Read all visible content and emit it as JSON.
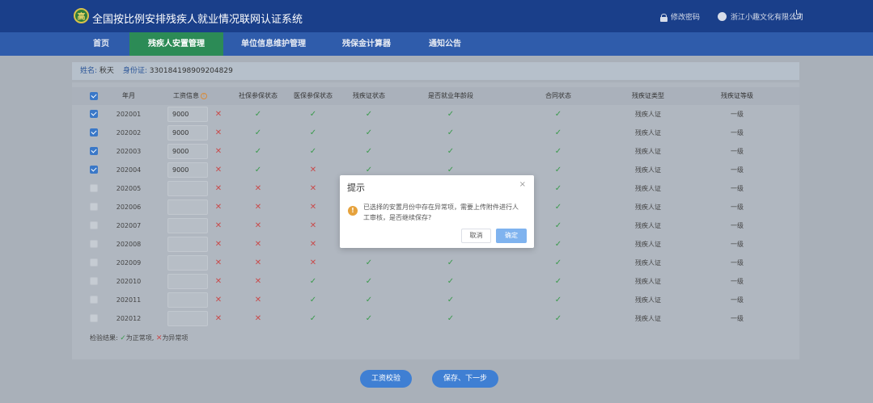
{
  "header": {
    "system_title": "全国按比例安排残疾人就业情况联网认证系统",
    "logo_glyph": "高",
    "change_password": "修改密码",
    "company_name": "浙江小趣文化有限公司"
  },
  "nav": [
    "首页",
    "残疾人安置管理",
    "单位信息维护管理",
    "残保金计算器",
    "通知公告"
  ],
  "info": {
    "name_label": "姓名:",
    "name_value": "秋天",
    "id_label": "身份证:",
    "id_value": "330184198909204829"
  },
  "table": {
    "headers": [
      "年月",
      "工资信息",
      "社保参保状态",
      "医保参保状态",
      "残疾证状态",
      "是否就业年龄段",
      "合同状态",
      "残疾证类型",
      "残疾证等级"
    ],
    "rows": [
      {
        "month": "202001",
        "checked": true,
        "wage": "9000",
        "wage_ok": false,
        "social": true,
        "medical": true,
        "disability": true,
        "age": true,
        "contract": true,
        "type": "残疾人证",
        "level": "一级"
      },
      {
        "month": "202002",
        "checked": true,
        "wage": "9000",
        "wage_ok": false,
        "social": true,
        "medical": true,
        "disability": true,
        "age": true,
        "contract": true,
        "type": "残疾人证",
        "level": "一级"
      },
      {
        "month": "202003",
        "checked": true,
        "wage": "9000",
        "wage_ok": false,
        "social": true,
        "medical": true,
        "disability": true,
        "age": true,
        "contract": true,
        "type": "残疾人证",
        "level": "一级"
      },
      {
        "month": "202004",
        "checked": true,
        "wage": "9000",
        "wage_ok": false,
        "social": true,
        "medical": false,
        "disability": true,
        "age": true,
        "contract": true,
        "type": "残疾人证",
        "level": "一级"
      },
      {
        "month": "202005",
        "checked": false,
        "wage": "",
        "wage_ok": false,
        "social": false,
        "medical": false,
        "disability": true,
        "age": true,
        "contract": true,
        "type": "残疾人证",
        "level": "一级"
      },
      {
        "month": "202006",
        "checked": false,
        "wage": "",
        "wage_ok": false,
        "social": false,
        "medical": false,
        "disability": true,
        "age": true,
        "contract": true,
        "type": "残疾人证",
        "level": "一级"
      },
      {
        "month": "202007",
        "checked": false,
        "wage": "",
        "wage_ok": false,
        "social": false,
        "medical": false,
        "disability": true,
        "age": true,
        "contract": true,
        "type": "残疾人证",
        "level": "一级"
      },
      {
        "month": "202008",
        "checked": false,
        "wage": "",
        "wage_ok": false,
        "social": false,
        "medical": false,
        "disability": true,
        "age": true,
        "contract": true,
        "type": "残疾人证",
        "level": "一级"
      },
      {
        "month": "202009",
        "checked": false,
        "wage": "",
        "wage_ok": false,
        "social": false,
        "medical": false,
        "disability": true,
        "age": true,
        "contract": true,
        "type": "残疾人证",
        "level": "一级"
      },
      {
        "month": "202010",
        "checked": false,
        "wage": "",
        "wage_ok": false,
        "social": false,
        "medical": true,
        "disability": true,
        "age": true,
        "contract": true,
        "type": "残疾人证",
        "level": "一级"
      },
      {
        "month": "202011",
        "checked": false,
        "wage": "",
        "wage_ok": false,
        "social": false,
        "medical": true,
        "disability": true,
        "age": true,
        "contract": true,
        "type": "残疾人证",
        "level": "一级"
      },
      {
        "month": "202012",
        "checked": false,
        "wage": "",
        "wage_ok": false,
        "social": false,
        "medical": true,
        "disability": true,
        "age": true,
        "contract": true,
        "type": "残疾人证",
        "level": "一级"
      }
    ]
  },
  "symbols": {
    "ok": "✓",
    "bad": "✕"
  },
  "legend": {
    "prefix": "检验结果:",
    "normal": "为正常项,",
    "abnormal": "为异常项"
  },
  "buttons": {
    "check_wage": "工资校验",
    "save_next": "保存、下一步"
  },
  "modal": {
    "title": "提示",
    "close": "×",
    "warn_glyph": "!",
    "message": "已选择的安置月份中存在异常项，需要上传附件进行人工审核，是否继续保存?",
    "cancel": "取消",
    "confirm": "确定"
  },
  "colors": {
    "header_bg": "#1a3f8a",
    "nav_bg": "#2f5cab",
    "nav_active": "#2c8b56",
    "primary": "#3f7fd3",
    "ok": "#3a9a4c",
    "bad": "#c94a4a",
    "warn": "#e6a23c"
  }
}
